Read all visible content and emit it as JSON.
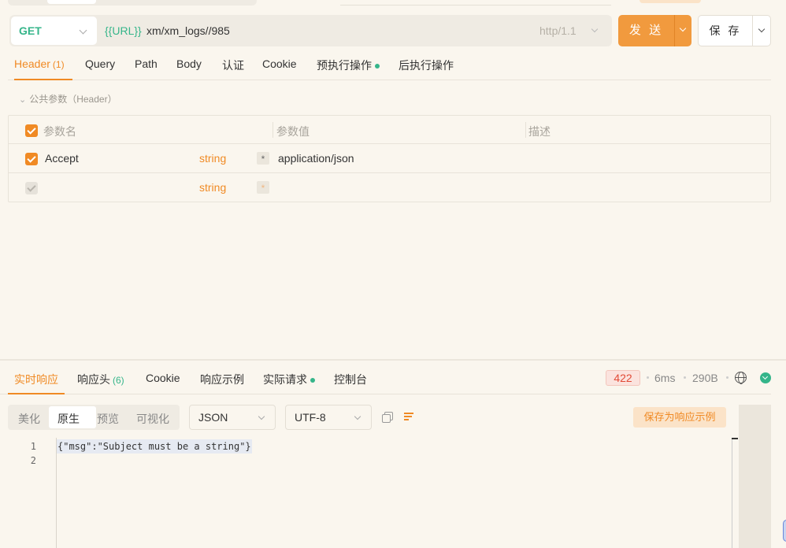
{
  "request": {
    "method": "GET",
    "url_template": "{{URL}}",
    "url_path": "xm/xm_logs//985",
    "protocol": "http/1.1",
    "send_label": "发 送",
    "save_label": "保 存"
  },
  "request_tabs": [
    {
      "label": "Header",
      "count": "(1)",
      "active": true
    },
    {
      "label": "Query"
    },
    {
      "label": "Path"
    },
    {
      "label": "Body"
    },
    {
      "label": "认证"
    },
    {
      "label": "Cookie"
    },
    {
      "label": "预执行操作",
      "dot": true
    },
    {
      "label": "后执行操作"
    }
  ],
  "public_params_label": "公共参数（Header）",
  "params_table": {
    "headers": [
      "参数名",
      "参数值",
      "描述"
    ],
    "rows": [
      {
        "name": "Accept",
        "type": "string",
        "required_mark": "*",
        "value": "application/json",
        "checked": true
      },
      {
        "name": "",
        "type": "string",
        "required_mark": "*",
        "value": "",
        "checked": false
      }
    ]
  },
  "response_tabs": [
    {
      "label": "实时响应",
      "active": true
    },
    {
      "label": "响应头",
      "count": "(6)"
    },
    {
      "label": "Cookie"
    },
    {
      "label": "响应示例"
    },
    {
      "label": "实际请求",
      "dot": true
    },
    {
      "label": "控制台"
    }
  ],
  "response_meta": {
    "status": "422",
    "time": "6ms",
    "size": "290B"
  },
  "view_modes": [
    "美化",
    "原生",
    "预览",
    "可视化"
  ],
  "active_view_mode": "原生",
  "format_select": "JSON",
  "encoding_select": "UTF-8",
  "save_as_example_label": "保存为响应示例",
  "code_lines": [
    {
      "no": "1",
      "text": "{\"msg\":\"Subject must be a string\"}"
    },
    {
      "no": "2",
      "text": ""
    }
  ],
  "colors": {
    "accent": "#f08a24",
    "green": "#35b58a",
    "error": "#e24a36"
  },
  "icons": [
    "chevron-down-icon",
    "globe-icon",
    "download-icon",
    "copy-icon",
    "wrap-lines-icon",
    "checkbox-icon"
  ]
}
